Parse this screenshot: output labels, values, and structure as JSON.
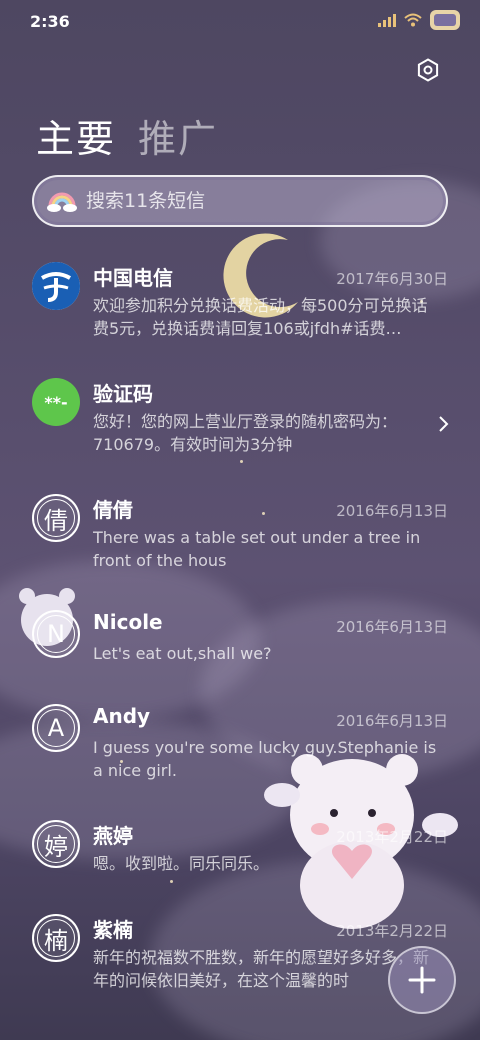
{
  "status_bar": {
    "time": "2:36"
  },
  "tabs": [
    {
      "label": "主要",
      "active": true
    },
    {
      "label": "推广",
      "active": false
    }
  ],
  "search": {
    "placeholder": "搜索11条短信"
  },
  "messages": [
    {
      "name": "中国电信",
      "date": "2017年6月30日",
      "preview": "欢迎参加积分兑换话费活动，每500分可兑换话费5元，兑换话费请回复106或jfdh#话费…",
      "avatar_type": "telecom-logo"
    },
    {
      "name": "验证码",
      "date": "",
      "preview": "您好！您的网上营业厅登录的随机密码为：710679。有效时间为3分钟",
      "avatar_type": "code",
      "avatar_text": "**-",
      "has_chevron": true
    },
    {
      "name": "倩倩",
      "date": "2016年6月13日",
      "preview": "There was a table set out under a tree in front of the hous",
      "avatar_text": "倩"
    },
    {
      "name": "Nicole",
      "date": "2016年6月13日",
      "preview": "Let's eat out,shall we?",
      "avatar_text": "N"
    },
    {
      "name": "Andy",
      "date": "2016年6月13日",
      "preview": "I guess you're some lucky guy.Stephanie is a nice girl.",
      "avatar_text": "A"
    },
    {
      "name": "燕婷",
      "date": "2013年2月22日",
      "preview": "嗯。收到啦。同乐同乐。",
      "avatar_text": "婷"
    },
    {
      "name": "紫楠",
      "date": "2013年2月22日",
      "preview": "新年的祝福数不胜数，新年的愿望好多好多，新年的问候依旧美好，在这个温馨的时",
      "avatar_text": "楠"
    }
  ],
  "colors": {
    "background": "#524a67",
    "code_avatar": "#5ec64b",
    "telecom_blue": "#1a5fb4"
  },
  "icons": {
    "settings": "settings-icon",
    "search": "rainbow-cloud-icon",
    "fab": "plus-icon"
  }
}
